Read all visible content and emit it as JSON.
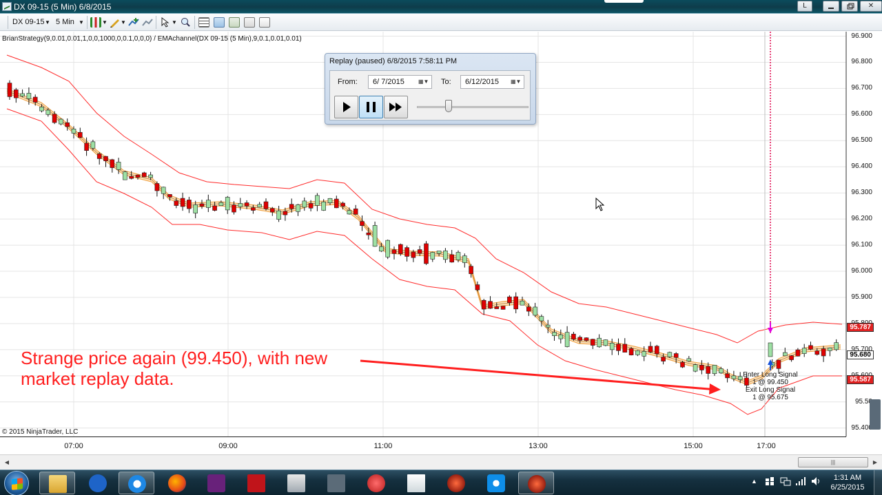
{
  "window": {
    "title": "DX 09-15 (5 Min)  6/8/2015",
    "buttons": [
      "L",
      "",
      "",
      "✕"
    ]
  },
  "toolbar": {
    "instrument": "DX 09-15",
    "interval": "5 Min"
  },
  "chart": {
    "indicator_label": "BrianStrategy(9,0.01,0.01,1,0,0,1000,0,0.1,0,0,0) / EMAchannel(DX 09-15 (5 Min),9,0.1,0.01,0.01)",
    "copyright": "© 2015 NinjaTrader, LLC",
    "price_axis": [
      "96.900",
      "96.800",
      "96.700",
      "96.600",
      "96.500",
      "96.400",
      "96.300",
      "96.200",
      "96.100",
      "96.000",
      "95.900",
      "95.800",
      "95.700",
      "95.600",
      "95.500",
      "95.400"
    ],
    "price_axis_truncated": "95.50",
    "time_axis": [
      "07:00",
      "09:00",
      "11:00",
      "13:00",
      "15:00",
      "17:00"
    ],
    "price_markers": {
      "upper": "95.787",
      "last": "95.680",
      "lower": "95.587"
    },
    "signals": {
      "enter_label": "Enter Long Signal",
      "enter_qty": "1 @ 99.450",
      "exit_label": "Exit Long Signal",
      "exit_qty": "1 @ 95.675"
    },
    "colors": {
      "up_candle": "#9ee0a4",
      "down_candle": "#e00000",
      "channel": "#ff2a2a",
      "ema_band": "#f2a64a",
      "vertical_marker": "#e0004a"
    }
  },
  "replay": {
    "title": "Replay (paused) 6/8/2015 7:58:11 PM",
    "from_label": "From:",
    "from_value": "6/  7/2015",
    "to_label": "To:",
    "to_value": "6/12/2015",
    "speed_slider_fraction": 0.27
  },
  "annotation": {
    "line1": "Strange price again (99.450), with new",
    "line2": "market replay data."
  },
  "taskbar": {
    "apps": [
      "windows-explorer",
      "aol",
      "internet-explorer",
      "firefox",
      "visual-studio",
      "filezilla",
      "calculator",
      "sync-app",
      "red-app",
      "document-app",
      "ninjatrader",
      "teamviewer",
      "ninjatrader-active"
    ],
    "clock_time": "1:31 AM",
    "clock_date": "6/25/2015"
  }
}
